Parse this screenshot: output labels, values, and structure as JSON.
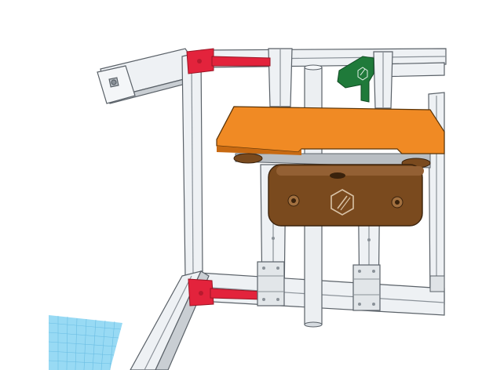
{
  "app": {
    "view": "3d-workplane",
    "background_color": "#ffffff",
    "workplane_grid_color": "#7fd0f0"
  },
  "scene": {
    "parts": [
      {
        "name": "aluminum-extrusion-frame",
        "color": "#e6eaee"
      },
      {
        "name": "corner-bracket-top",
        "color": "#e0203a"
      },
      {
        "name": "corner-bracket-bottom",
        "color": "#e0203a"
      },
      {
        "name": "print-bed-plate",
        "color": "#f08a24"
      },
      {
        "name": "bed-carriage-block",
        "color": "#7a4a1e"
      },
      {
        "name": "t-nut-handle",
        "color": "#1f7a3a"
      },
      {
        "name": "z-axis-rod",
        "color": "#e8ecef"
      },
      {
        "name": "linear-bearing-left",
        "color": "#dfe3e6"
      },
      {
        "name": "linear-bearing-right",
        "color": "#dfe3e6"
      }
    ],
    "logo_icon": "hex-slash-logo-icon"
  }
}
